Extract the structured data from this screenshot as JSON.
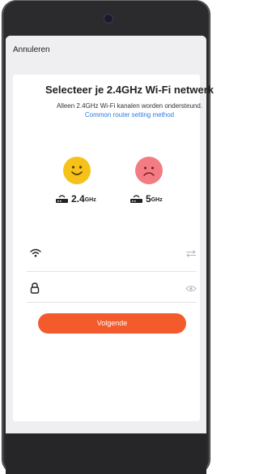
{
  "nav": {
    "cancel_label": "Annuleren"
  },
  "content": {
    "title": "Selecteer je 2.4GHz Wi-Fi netwerk",
    "subtitle": "Alleen 2.4GHz Wi-Fi kanalen worden ondersteund.",
    "router_link": "Common router setting method"
  },
  "bands": [
    {
      "value": "2.4",
      "unit": "GHz",
      "icon": "happy-face-icon",
      "color": "#f6c21a"
    },
    {
      "value": "5",
      "unit": "GHz",
      "icon": "sad-face-icon",
      "color": "#f37c84"
    }
  ],
  "form": {
    "wifi_icon": "wifi-icon",
    "switch_icon": "switch-network-icon",
    "lock_icon": "lock-icon",
    "eye_icon": "eye-icon"
  },
  "actions": {
    "next_label": "Volgende",
    "next_color": "#f35a2c"
  }
}
